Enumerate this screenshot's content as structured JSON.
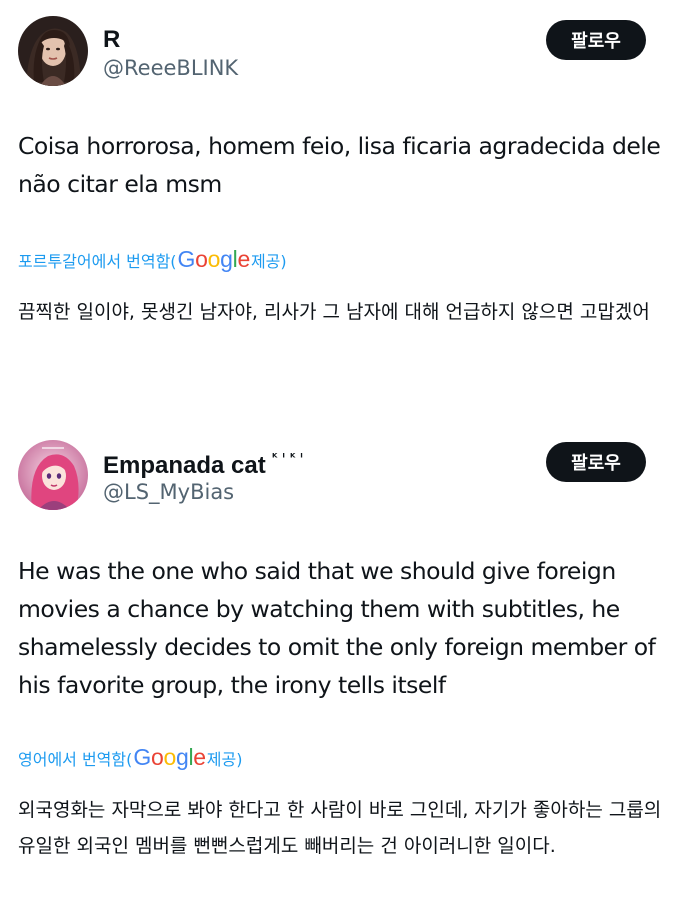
{
  "tweets": [
    {
      "display_name": "R",
      "badge": "",
      "handle": "@ReeeBLINK",
      "follow_label": "팔로우",
      "text": "Coisa horrorosa, homem feio, lisa ficaria agradecida dele não citar ela msm",
      "translate_prefix": "포르투갈어에서 번역함(",
      "translate_suffix": " 제공)",
      "translated_text": "끔찍한 일이야, 못생긴 남자야, 리사가 그 남자에 대해 언급하지 않으면 고맙겠어",
      "avatar_icon": "profile-photo-dark-hair"
    },
    {
      "display_name": "Empanada cat",
      "badge": "ᴷᴵᴷᴵ",
      "handle": "@LS_MyBias",
      "follow_label": "팔로우",
      "text": "He was the one who said that we should give foreign movies a chance by watching them with subtitles, he shamelessly decides to omit the only foreign member of his favorite group, the irony tells itself",
      "translate_prefix": "영어에서 번역함(",
      "translate_suffix": " 제공)",
      "translated_text": "외국영화는 자막으로 봐야 한다고 한 사람이 바로 그인데, 자기가 좋아하는 그룹의 유일한 외국인 멤버를 뻔뻔스럽게도 빼버리는 건 아이러니한 일이다.",
      "avatar_icon": "anime-pink-hair-avatar"
    }
  ],
  "google_logo": {
    "letters": [
      "G",
      "o",
      "o",
      "g",
      "l",
      "e"
    ],
    "colors": [
      "#4285F4",
      "#EA4335",
      "#FBBC05",
      "#4285F4",
      "#34A853",
      "#EA4335"
    ]
  },
  "colors": {
    "accent": "#1d9bf0",
    "secondary_text": "#536471",
    "follow_button_bg": "#0f1419"
  }
}
